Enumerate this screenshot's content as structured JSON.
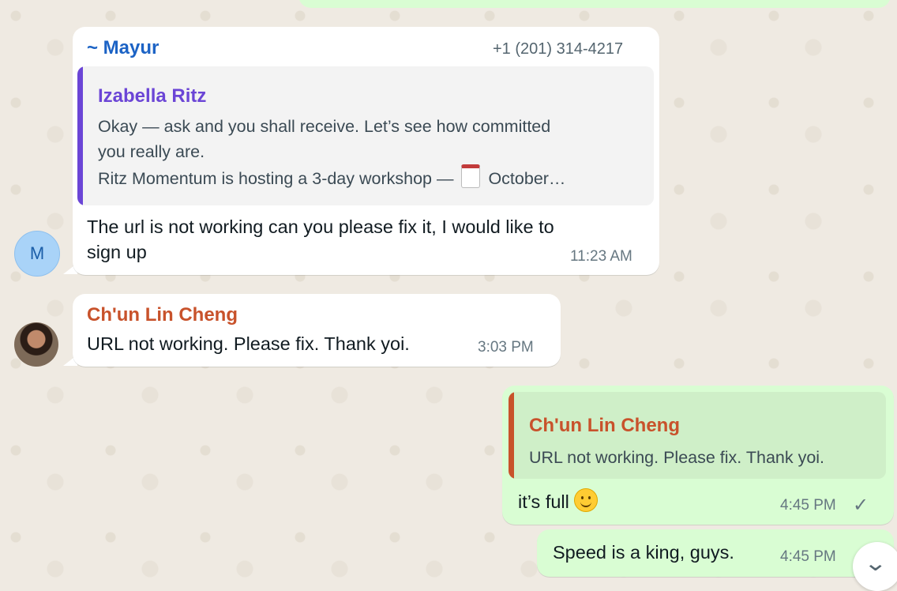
{
  "messages": {
    "mayur": {
      "sender": "~ Mayur",
      "phone": "+1 (201) 314-4217",
      "avatar_letter": "M",
      "quote": {
        "name": "Izabella Ritz",
        "line1": "Okay — ask and you shall receive. Let’s see how committed",
        "line2": "you really are.",
        "line3_pre": "Ritz Momentum is hosting a 3-day workshop —",
        "line3_icon": "calendar-icon",
        "line3_post": "October…"
      },
      "line1": "The url is not working can you please fix it, I would like to",
      "line2": "sign up",
      "time": "11:23 AM"
    },
    "chun": {
      "sender": "Ch'un Lin Cheng",
      "text": "URL not working. Please fix. Thank yoi.",
      "time": "3:03 PM"
    },
    "reply_full": {
      "quote_name": "Ch'un Lin Cheng",
      "quote_text": "URL not working. Please fix. Thank yoi.",
      "text": "it’s full",
      "emoji": "slightly-smiling-face",
      "time": "4:45 PM",
      "status": "✓"
    },
    "speed": {
      "text": "Speed is a king, guys.",
      "time": "4:45 PM"
    }
  },
  "scroll_down_icon": "chevron-down-icon",
  "colors": {
    "background": "#efeae2",
    "incoming": "#ffffff",
    "outgoing": "#d9fdd3",
    "mayur_name": "#1c63c5",
    "izabella_name": "#6b45d6",
    "chun_name": "#c8522b"
  }
}
